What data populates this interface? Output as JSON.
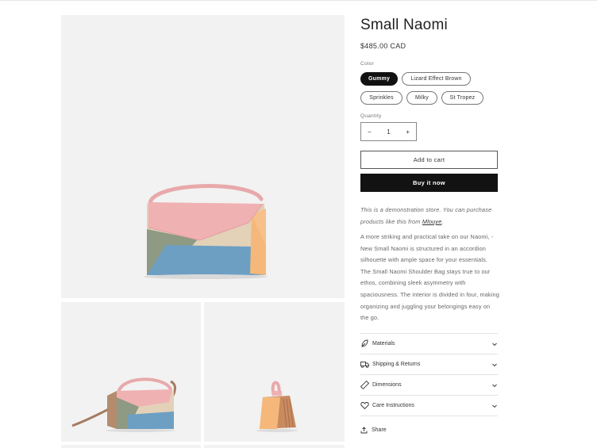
{
  "product": {
    "title": "Small Naomi",
    "price": "$485.00 CAD",
    "color_label": "Color",
    "colors": [
      "Gummy",
      "Lizard Effect Brown",
      "Sprinkles",
      "Milky",
      "St Tropez"
    ],
    "selected_color": "Gummy",
    "quantity_label": "Quantity",
    "quantity": "1",
    "minus": "−",
    "plus": "+",
    "add_to_cart": "Add to cart",
    "buy_now": "Buy it now",
    "demo_text": "This is a demonstration store. You can purchase products like this from",
    "demo_link": "Mlouye",
    "description": "A more striking and practical take on our Naomi, - New Small Naomi is structured in an accordion silhouette with ample space for your essentials. The Small Naomi Shoulder Bag stays true to our ethos, combining sleek asymmetry with spaciousness. The interior is divided in four, making organizing and juggling your belongings easy on the go."
  },
  "accordion": [
    {
      "label": "Materials",
      "icon": "leaf-icon"
    },
    {
      "label": "Shipping & Returns",
      "icon": "truck-icon"
    },
    {
      "label": "Dimensions",
      "icon": "ruler-icon"
    },
    {
      "label": "Care Instructions",
      "icon": "heart-icon"
    }
  ],
  "share_label": "Share",
  "colors": {
    "pink": "#f0b1b3",
    "beige": "#e3d1b8",
    "blue": "#6d9fc3",
    "olive": "#8e9a83",
    "orange": "#f5b87a",
    "tan": "#c39b7c"
  }
}
